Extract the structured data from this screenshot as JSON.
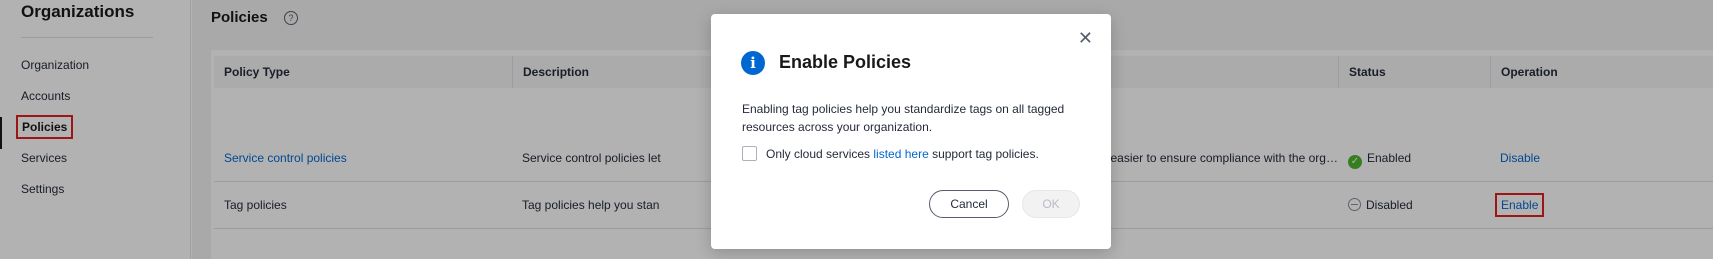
{
  "sidebar": {
    "title": "Organizations",
    "items": [
      {
        "label": "Organization"
      },
      {
        "label": "Accounts"
      },
      {
        "label": "Policies"
      },
      {
        "label": "Services"
      },
      {
        "label": "Settings"
      }
    ],
    "active": "Policies"
  },
  "page": {
    "title": "Policies",
    "help_icon": "question-circle-icon"
  },
  "table": {
    "columns": [
      "Policy Type",
      "Description",
      "Status",
      "Operation"
    ],
    "rows": [
      {
        "policy_type": "Service control policies",
        "description_left": "Service control policies let",
        "description_right": "ion. This makes it easier to ensure compliance with the organizati...",
        "status": "Enabled",
        "status_icon": "check-circle-icon",
        "operation": "Disable"
      },
      {
        "policy_type": "Tag policies",
        "description_left": "Tag policies help you stan",
        "description_right": "",
        "status": "Disabled",
        "status_icon": "minus-circle-icon",
        "operation": "Enable"
      }
    ]
  },
  "dialog": {
    "title": "Enable Policies",
    "info_icon": "info-icon",
    "close_icon": "close-icon",
    "body": "Enabling tag policies help you standardize tags on all tagged resources across your organization.",
    "checkbox_prefix": "Only cloud services ",
    "checkbox_link": "listed here",
    "checkbox_suffix": " support tag policies.",
    "cancel_label": "Cancel",
    "ok_label": "OK"
  },
  "colors": {
    "accent": "#0067d1",
    "enabled": "#50b432",
    "highlight": "#e02020"
  }
}
